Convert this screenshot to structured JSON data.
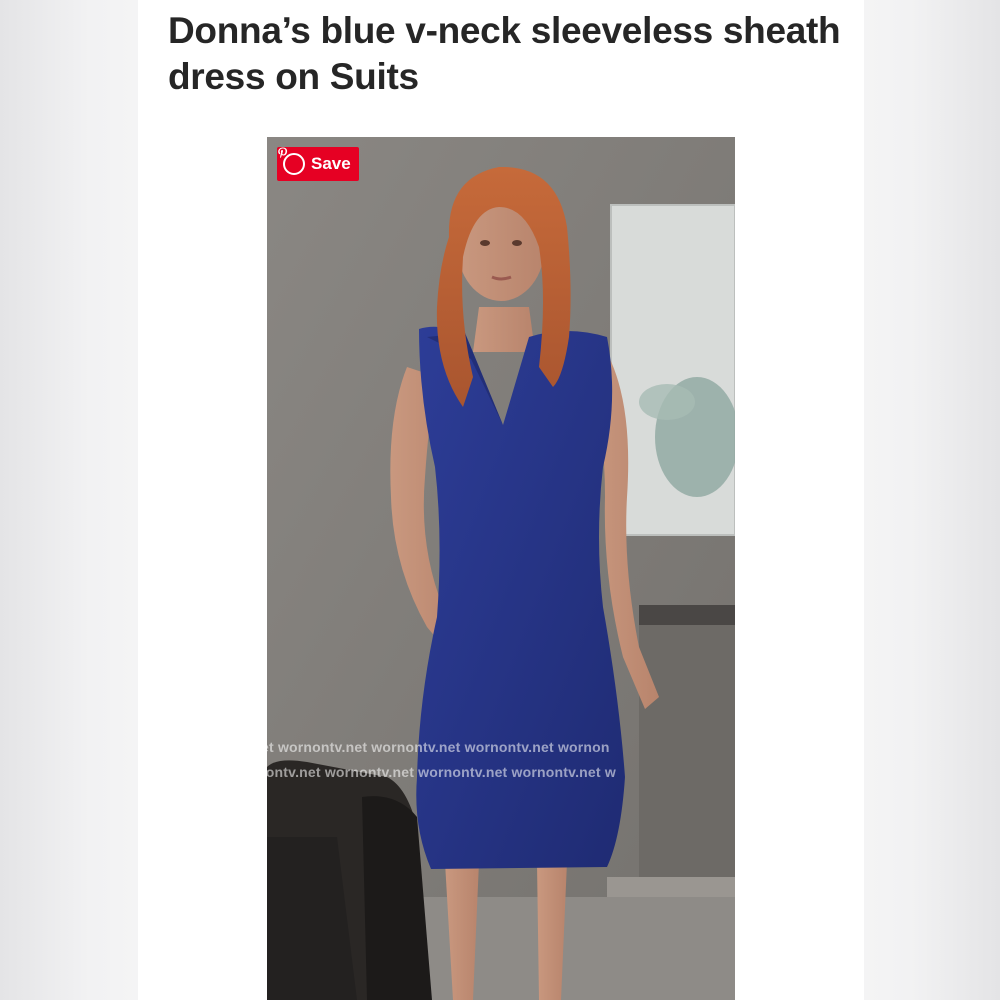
{
  "article": {
    "title": "Donna’s blue v-neck sleeveless sheath dress on Suits"
  },
  "photo": {
    "save_label": "Save",
    "watermark_line1": "et  wornontv.net  wornontv.net  wornontv.net  wornon",
    "watermark_line2": "nontv.net  wornontv.net  wornontv.net  wornontv.net  w"
  },
  "colors": {
    "pinterest_red": "#e60023",
    "dress_blue": "#27358a",
    "title_text": "#262626"
  }
}
